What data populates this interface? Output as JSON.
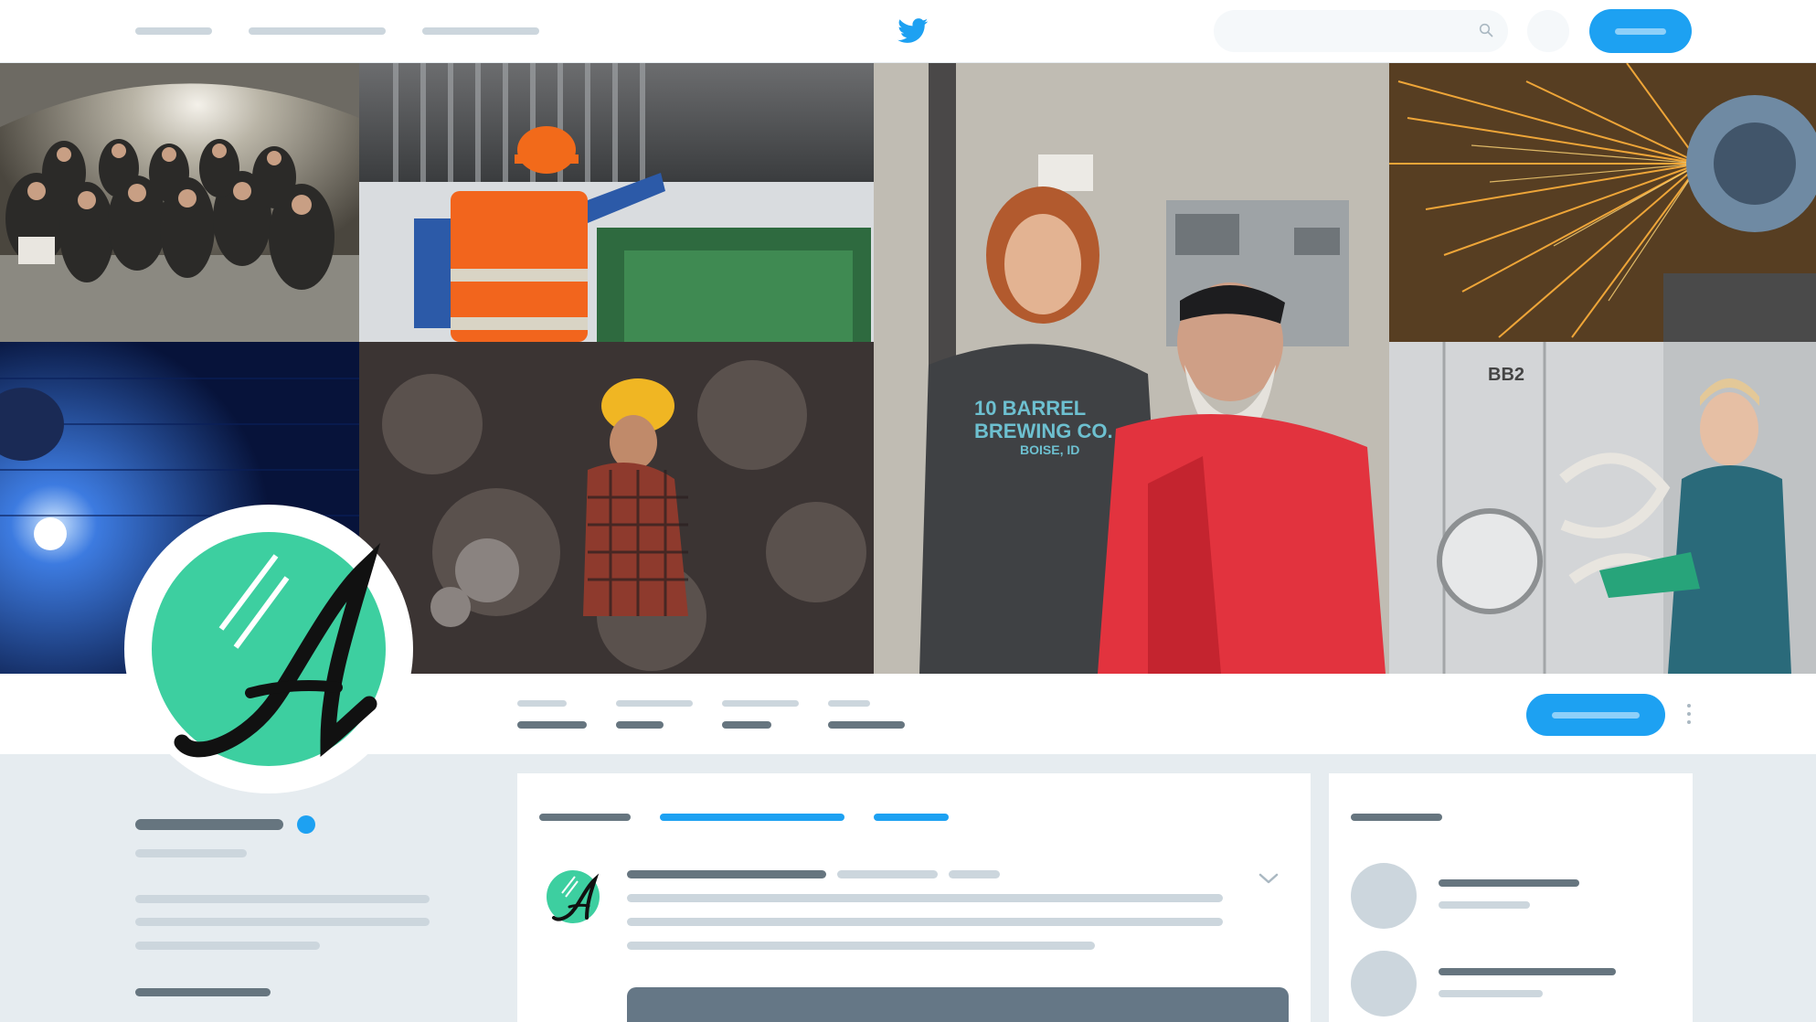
{
  "app": {
    "name": "Twitter",
    "brand_color": "#1da1f2"
  },
  "nav": {
    "icons": [
      "home-icon",
      "notifications-icon",
      "messages-icon"
    ]
  },
  "header": {
    "tiles": [
      "group-photo-in-warehouse",
      "worker-in-orange-vest-with-hard-hat",
      "brewery-staff-portrait",
      "metal-grinding-sparks",
      "welding-torch",
      "woman-in-yellow-hard-hat-at-machine",
      "brewery-worker-at-tank"
    ]
  },
  "brewery_shirt_text": [
    "10 BARREL",
    "BREWING CO.",
    "BOISE, ID"
  ],
  "tank_label": "BB2",
  "avatar": {
    "letter": "A",
    "color": "#3dcfa0"
  },
  "feed": {
    "tabs": [
      "tab-tweets",
      "tab-tweets-and-replies",
      "tab-media"
    ]
  }
}
